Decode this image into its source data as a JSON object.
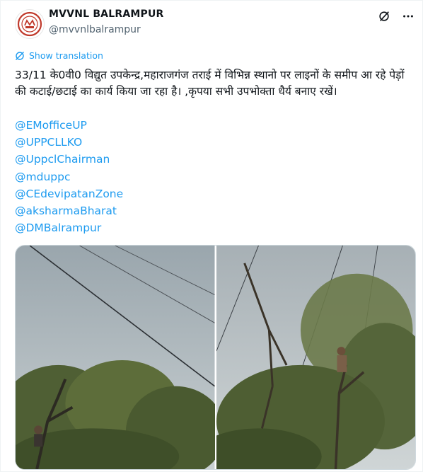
{
  "account": {
    "display_name": "MVVNL BALRAMPUR",
    "handle": "@mvvnlbalrampur"
  },
  "icons": {
    "grok": "grok-slash-icon",
    "more": "more-horizontal-icon",
    "translate": "globe-translate-icon"
  },
  "translation": {
    "link_label": "Show translation"
  },
  "post": {
    "text": "33/11 के0वी0 विद्युत  उपकेन्द्र,महाराजगंज तराई में विभिन्न स्थानो पर लाइनों के समीप आ रहे पेड़ों की कटाई/छटाई का कार्य किया जा रहा है। ,कृपया सभी उपभोक्ता धैर्य बनाए रखें।",
    "mentions": [
      "@EMofficeUP",
      "@UPPCLLKO",
      "@UppclChairman",
      "@mduppc",
      "@CEdevipatanZone",
      "@aksharmaBharat",
      "@DMBalrampur"
    ]
  },
  "colors": {
    "link": "#1d9bf0",
    "text": "#0f1419",
    "secondary": "#536471"
  }
}
